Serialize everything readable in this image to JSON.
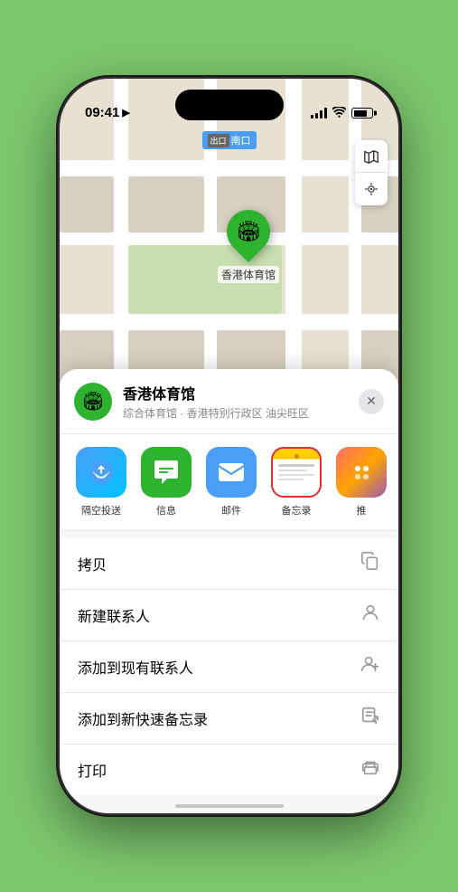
{
  "status_bar": {
    "time": "09:41",
    "location_arrow": "▶"
  },
  "map": {
    "label": "南口",
    "pin_venue": "香港体育馆",
    "pin_emoji": "🏟"
  },
  "map_controls": {
    "map_icon": "🗺",
    "compass_icon": "➤"
  },
  "venue_card": {
    "name": "香港体育馆",
    "description": "综合体育馆 · 香港特别行政区 油尖旺区",
    "close": "✕",
    "icon_emoji": "🏟"
  },
  "share_apps": [
    {
      "id": "airdrop",
      "label": "隔空投送",
      "type": "airdrop"
    },
    {
      "id": "messages",
      "label": "信息",
      "type": "messages"
    },
    {
      "id": "mail",
      "label": "邮件",
      "type": "mail"
    },
    {
      "id": "notes",
      "label": "备忘录",
      "type": "notes-selected"
    },
    {
      "id": "more",
      "label": "推",
      "type": "more"
    }
  ],
  "action_items": [
    {
      "label": "拷贝",
      "icon": "copy"
    },
    {
      "label": "新建联系人",
      "icon": "person-add"
    },
    {
      "label": "添加到现有联系人",
      "icon": "person-plus"
    },
    {
      "label": "添加到新快速备忘录",
      "icon": "note-add"
    },
    {
      "label": "打印",
      "icon": "printer"
    }
  ]
}
